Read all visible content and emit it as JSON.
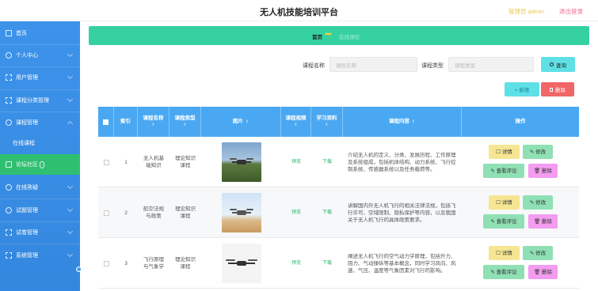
{
  "header": {
    "title": "无人机技能培训平台",
    "admin": "管理员 admin",
    "logout": "退出登录"
  },
  "sidebar": {
    "items": [
      {
        "label": "首页"
      },
      {
        "label": "个人中心"
      },
      {
        "label": "用户管理"
      },
      {
        "label": "课程分类管理"
      },
      {
        "label": "课程管理"
      },
      {
        "label": "在线课程"
      },
      {
        "label": "论坛社区"
      },
      {
        "label": "在线答疑"
      },
      {
        "label": "试题管理"
      },
      {
        "label": "试卷管理"
      },
      {
        "label": "系统管理"
      }
    ]
  },
  "breadcrumb": {
    "home": "首页",
    "hearts": "♥♥♥",
    "current": "在线课程"
  },
  "search": {
    "name_label": "课程名称",
    "name_placeholder": "课程名称",
    "type_label": "课程类型",
    "type_placeholder": "课程类型",
    "query": "查询",
    "add": "+ 新增",
    "delete": "删除"
  },
  "table": {
    "headers": {
      "index": "索引",
      "name": "课程名称",
      "type": "课程类型",
      "image": "图片",
      "video": "课程视频",
      "material": "学习资料",
      "content": "课程内容",
      "action": "操作"
    },
    "sort": "⇕",
    "rows": [
      {
        "index": "1",
        "name": "无人机基础知识",
        "type": "理论知识课程",
        "video": "预览",
        "material": "下载",
        "content": "介绍无人机的定义、分类、发展历程、工作原理及系统组成，包括机体结构、动力系统、飞行控制系统、传感器系统以及任务载荷等。"
      },
      {
        "index": "2",
        "name": "航空法规与政策",
        "type": "理论知识课程",
        "video": "预览",
        "material": "下载",
        "content": "讲解国内外无人机飞行的相关法律法规，包括飞行许可、空域限制、隐私保护等内容，以及我国关于无人机飞行的具体政策要求。"
      },
      {
        "index": "3",
        "name": "飞行原理与气象学",
        "type": "理论知识课程",
        "video": "预览",
        "material": "下载",
        "content": "阐述无人机飞行的空气动力学原理，包括升力、阻力、气动操纵等基本概念，同时学习风向、风速、气压、温度等气象因素对飞行的影响。"
      }
    ],
    "actions": {
      "detail": "☐ 详情",
      "edit": "✎ 修改",
      "comment": "✎ 查看评论",
      "delete": "🗑 删除"
    }
  }
}
